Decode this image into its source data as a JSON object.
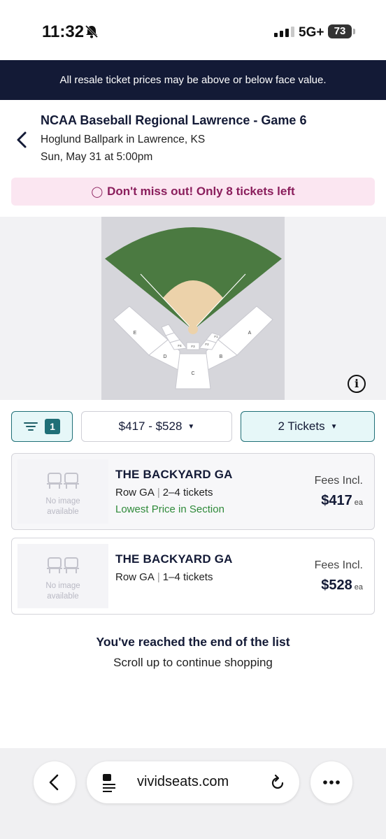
{
  "status_bar": {
    "time": "11:32",
    "network": "5G+",
    "battery": "73"
  },
  "banner": {
    "text": "All resale ticket prices may be above or below face value."
  },
  "event": {
    "title": "NCAA Baseball Regional Lawrence - Game 6",
    "venue": "Hoglund Ballpark in Lawrence, KS",
    "date": "Sun, May 31 at 5:00pm"
  },
  "urgency": {
    "icon": "flame-icon",
    "text": "Don't miss out! Only 8 tickets left"
  },
  "map": {
    "section_labels": [
      "E",
      "A",
      "D",
      "B",
      "C",
      "F4",
      "F3",
      "F2",
      "F1",
      "F6",
      "F5"
    ],
    "field_color": "#4b7a41",
    "infield_color": "#ecd2aa"
  },
  "filters": {
    "count": "1",
    "price_range": "$417 - $528",
    "tickets": "2 Tickets"
  },
  "listings": [
    {
      "section": "THE BACKYARD GA",
      "row": "Row GA",
      "quantity": "2–4 tickets",
      "note": "Lowest Price in Section",
      "no_image": [
        "No image",
        "available"
      ],
      "fees": "Fees Incl.",
      "price": "$417",
      "unit": "ea"
    },
    {
      "section": "THE BACKYARD GA",
      "row": "Row GA",
      "quantity": "1–4 tickets",
      "no_image": [
        "No image",
        "available"
      ],
      "fees": "Fees Incl.",
      "price": "$528",
      "unit": "ea"
    }
  ],
  "end_of_list": {
    "title": "You've reached the end of the list",
    "subtitle": "Scroll up to continue shopping"
  },
  "browser": {
    "url": "vividseats.com"
  },
  "colors": {
    "navy": "#131a36",
    "teal": "#1f6f77",
    "urgency_text": "#8a1e5c",
    "urgency_bg": "#fbe6f1",
    "green": "#2f8a3a"
  }
}
